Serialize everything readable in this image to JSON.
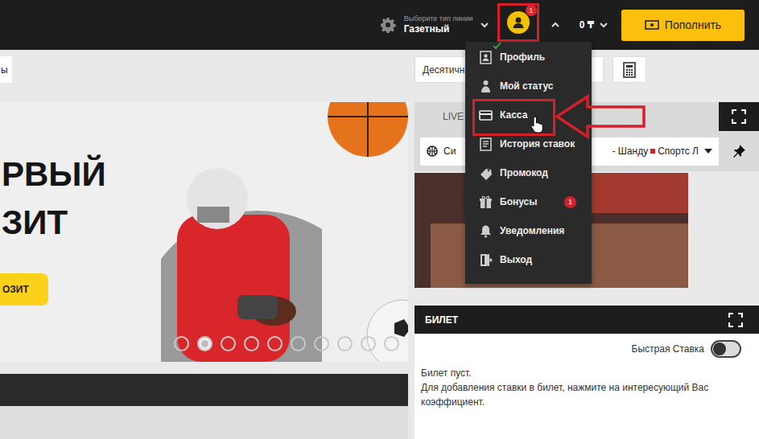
{
  "header": {
    "line_type_label": "Выберите тип линии",
    "line_type_value": "Газетный",
    "user_badge": "1",
    "balance": "0 ₸",
    "deposit_button": "Пополнить"
  },
  "user_menu": {
    "expanded": true,
    "items": [
      {
        "label": "Профиль",
        "selected": false
      },
      {
        "label": "Мой статус",
        "selected": false
      },
      {
        "label": "Касса",
        "selected": true
      },
      {
        "label": "История ставок",
        "selected": false
      },
      {
        "label": "Промокод",
        "selected": false
      },
      {
        "label": "Бонусы",
        "selected": false,
        "badge": "1"
      },
      {
        "label": "Уведомления",
        "selected": false
      },
      {
        "label": "Выход",
        "selected": false
      }
    ]
  },
  "left_tab": "ы",
  "odds_format": "Десятичн",
  "banner": {
    "lines": [
      "РВЫЙ",
      "ЗИТ"
    ],
    "button": "ОЗИТ",
    "slides": [
      {
        "selected": false
      },
      {
        "selected": true
      },
      {
        "selected": false
      },
      {
        "selected": false
      },
      {
        "selected": false
      },
      {
        "selected": false
      },
      {
        "selected": false
      },
      {
        "selected": false
      },
      {
        "selected": false
      },
      {
        "selected": false
      }
    ]
  },
  "live_panel": {
    "tab": "LIVE",
    "match_left": "Си",
    "match_right_a": "- Шанду",
    "match_right_b": "Спортс Л"
  },
  "ticket": {
    "title": "БИЛЕТ",
    "quick_bet_label": "Быстрая Ставка",
    "quick_bet_on": false,
    "empty_title": "Билет пуст.",
    "empty_hint": "Для добавления ставки в билет, нажмите на интересующий Вас коэффициент."
  }
}
